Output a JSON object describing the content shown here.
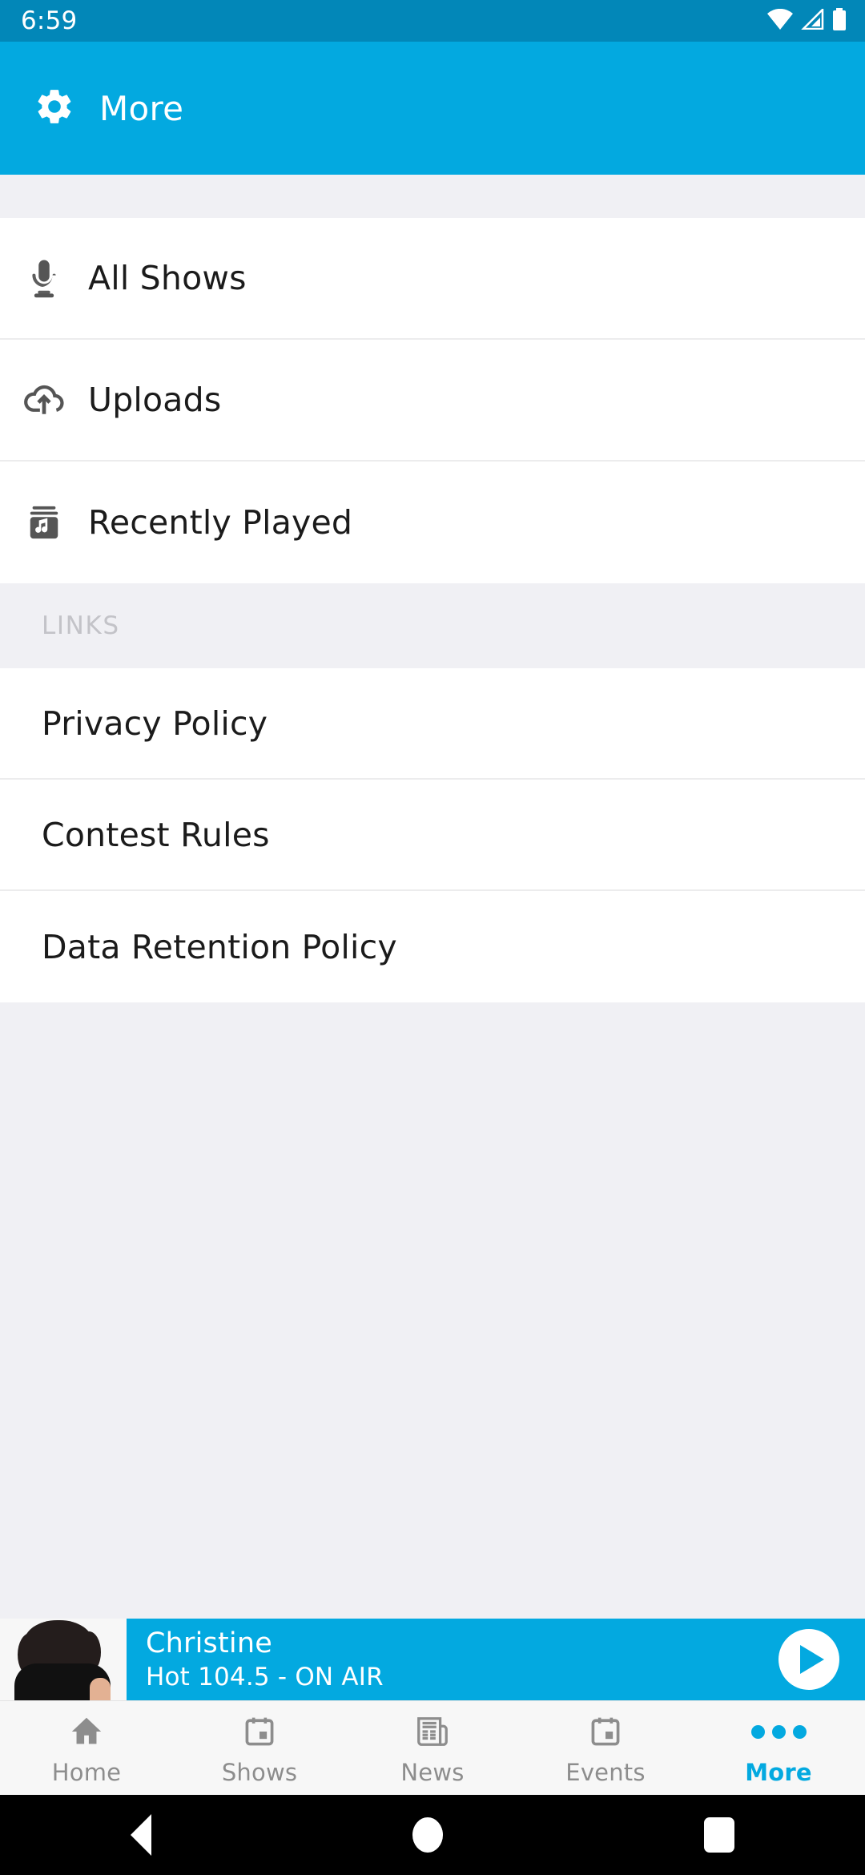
{
  "status_bar": {
    "time": "6:59",
    "icons": [
      "wifi-icon",
      "signal-icon",
      "battery-icon"
    ]
  },
  "app_bar": {
    "icon": "gear-icon",
    "title": "More",
    "background": "#03a9e0"
  },
  "menu": {
    "items": [
      {
        "label": "All Shows",
        "icon": "microphone-icon"
      },
      {
        "label": "Uploads",
        "icon": "cloud-upload-icon"
      },
      {
        "label": "Recently Played",
        "icon": "library-music-icon"
      }
    ]
  },
  "links_section": {
    "header": "LINKS",
    "items": [
      {
        "label": "Privacy Policy"
      },
      {
        "label": "Contest Rules"
      },
      {
        "label": "Data Retention Policy"
      }
    ]
  },
  "now_playing": {
    "title": "Christine",
    "subtitle": "Hot 104.5 - ON AIR",
    "play_button": "play-icon",
    "artwork": "dj-photo",
    "background": "#03a9e0"
  },
  "bottom_nav": {
    "active_color": "#03a9e0",
    "inactive_color": "#8d8d8d",
    "items": [
      {
        "label": "Home",
        "icon": "home-icon",
        "active": false
      },
      {
        "label": "Shows",
        "icon": "calendar-icon",
        "active": false
      },
      {
        "label": "News",
        "icon": "newspaper-icon",
        "active": false
      },
      {
        "label": "Events",
        "icon": "calendar-icon",
        "active": false
      },
      {
        "label": "More",
        "icon": "more-dots-icon",
        "active": true
      }
    ]
  },
  "android_nav": {
    "back": "back-triangle-icon",
    "home": "home-circle-icon",
    "recents": "recents-square-icon"
  }
}
